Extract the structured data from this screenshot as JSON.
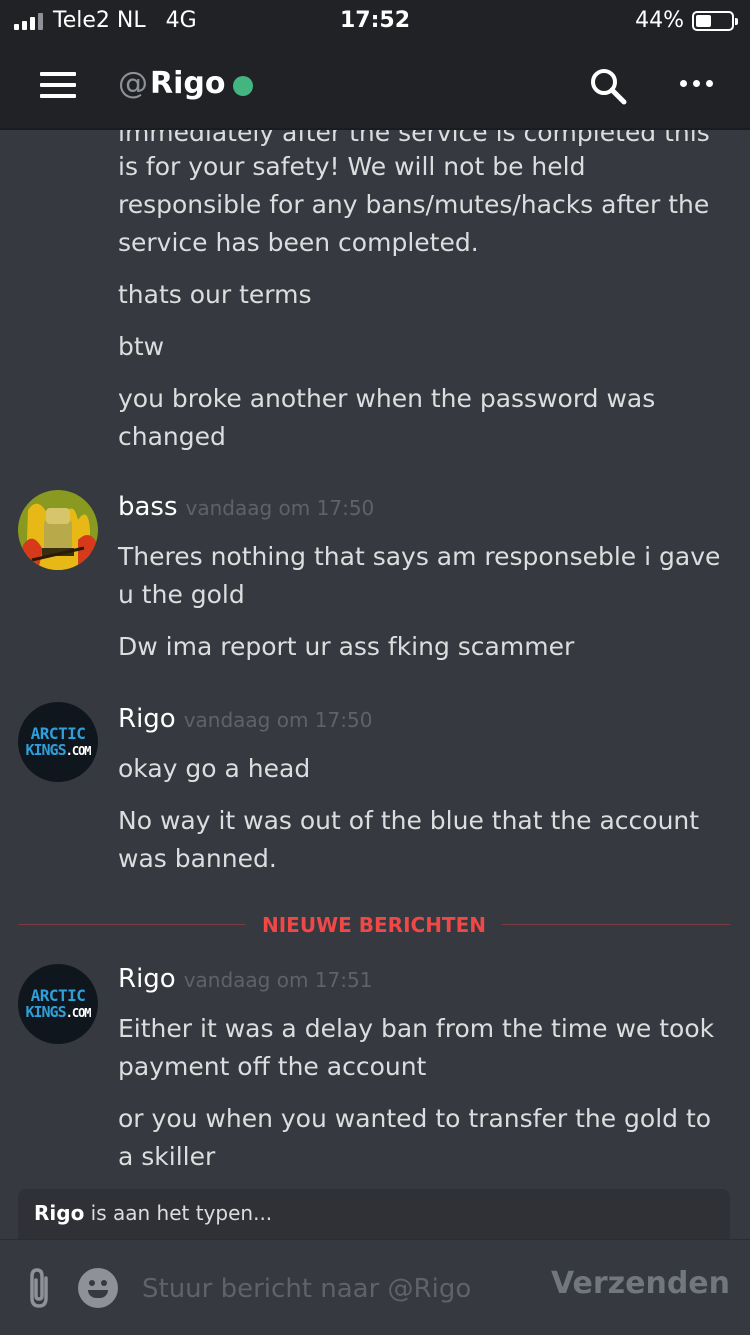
{
  "status_bar": {
    "carrier": "Tele2 NL",
    "network": "4G",
    "time": "17:52",
    "battery": "44%",
    "battery_level": 0.44
  },
  "header": {
    "at": "@",
    "channel_name": "Rigo",
    "status": "online",
    "status_color": "#43b581",
    "icons": [
      "menu-icon",
      "search-icon",
      "more-icon"
    ]
  },
  "messages": {
    "top_continued": [
      "immediately after the service is completed this",
      "is for your safety! We will not be held responsible for any bans/mutes/hacks after the service has been completed.",
      "thats our terms",
      "btw",
      "you broke another when the password was changed"
    ],
    "groups": [
      {
        "author": "bass",
        "timestamp": "vandaag om 17:50",
        "lines": [
          "Theres nothing that says am responseble i gave u the gold",
          "Dw ima report ur ass fking scammer"
        ]
      },
      {
        "author": "Rigo",
        "timestamp": "vandaag om 17:50",
        "avatar_text": [
          "ARCTIC",
          "KINGS",
          ".COM"
        ],
        "lines": [
          "okay go a head",
          "No way it was out of the blue that the account was banned."
        ]
      },
      {
        "author": "Rigo",
        "timestamp": "vandaag om 17:51",
        "avatar_text": [
          "ARCTIC",
          "KINGS",
          ".COM"
        ],
        "lines": [
          "Either it was a delay ban from the time we took payment off the account",
          "or you when you wanted to transfer the gold to a skiller"
        ]
      }
    ],
    "new_divider": "NIEUWE BERICHTEN"
  },
  "typing": {
    "user": "Rigo",
    "text": "is aan het typen..."
  },
  "composer": {
    "placeholder": "Stuur bericht naar @Rigo",
    "send_label": "Verzenden",
    "icons": [
      "paperclip-icon",
      "emoji-icon"
    ]
  }
}
